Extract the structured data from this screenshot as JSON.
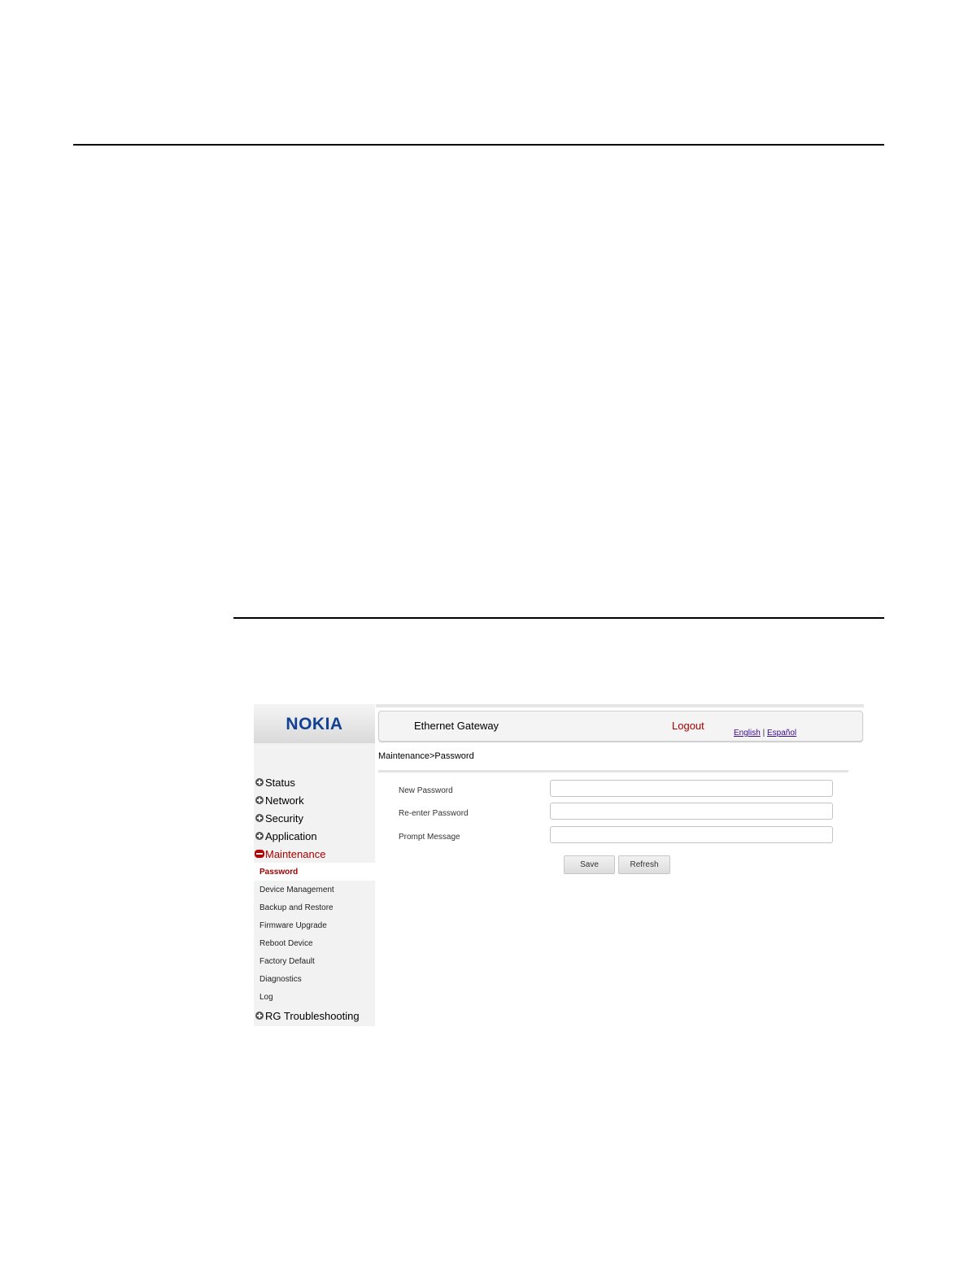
{
  "brand": {
    "logo_text": "NOKIA",
    "logo_color": "#124191"
  },
  "header": {
    "title": "Ethernet Gateway",
    "logout": "Logout",
    "lang_english": "English",
    "lang_separator": "|",
    "lang_espanol": "Español"
  },
  "breadcrumb": "Maintenance>Password",
  "sidebar": {
    "sections": [
      {
        "label": "Status",
        "icon": "plus-icon"
      },
      {
        "label": "Network",
        "icon": "plus-icon"
      },
      {
        "label": "Security",
        "icon": "plus-icon"
      },
      {
        "label": "Application",
        "icon": "plus-icon"
      },
      {
        "label": "Maintenance",
        "icon": "minus-icon",
        "expanded": true
      }
    ],
    "maintenance_items": [
      "Password",
      "Device Management",
      "Backup and Restore",
      "Firmware Upgrade",
      "Reboot Device",
      "Factory Default",
      "Diagnostics",
      "Log"
    ],
    "active_item": "Password",
    "last_section": {
      "label": "RG Troubleshooting",
      "icon": "plus-icon"
    }
  },
  "form": {
    "new_password_label": "New Password",
    "new_password_value": "",
    "reenter_password_label": "Re-enter Password",
    "reenter_password_value": "",
    "prompt_message_label": "Prompt Message",
    "prompt_message_value": "",
    "save_label": "Save",
    "refresh_label": "Refresh"
  },
  "colors": {
    "accent_red": "#a80000",
    "link_purple": "#3a0a8c"
  }
}
